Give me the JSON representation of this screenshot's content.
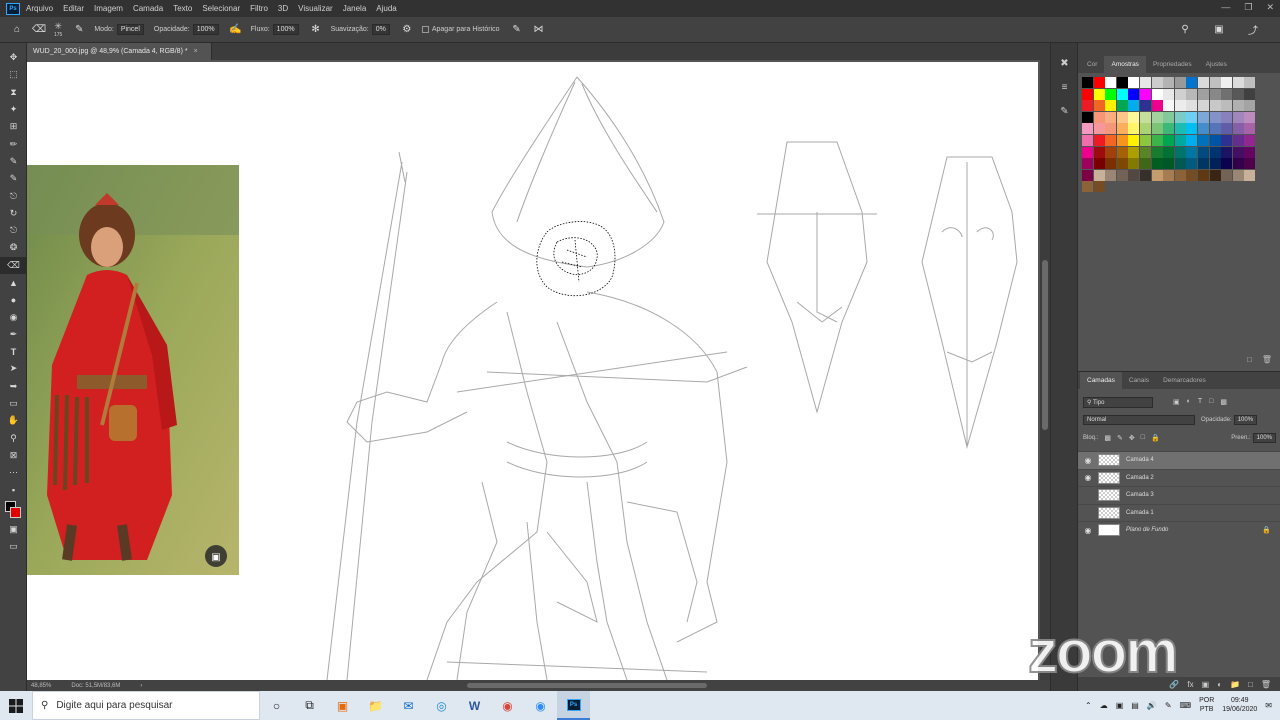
{
  "menubar": {
    "logo": "Ps",
    "items": [
      "Arquivo",
      "Editar",
      "Imagem",
      "Camada",
      "Texto",
      "Selecionar",
      "Filtro",
      "3D",
      "Visualizar",
      "Janela",
      "Ajuda"
    ]
  },
  "options": {
    "brush_size": "175",
    "mode_label": "Modo:",
    "mode_value": "Pincel",
    "opacity_label": "Opacidade:",
    "opacity_value": "100%",
    "flow_label": "Fluxo:",
    "flow_value": "100%",
    "smoothing_label": "Suavização:",
    "smoothing_value": "0%",
    "erase_history_label": "Apagar para Histórico"
  },
  "document": {
    "tab_title": "WUD_20_000.jpg @ 48,9% (Camada 4, RGB/8) *",
    "status_zoom": "48,85%",
    "status_doc": "Doc: 51,5M/83,6M"
  },
  "right_panel": {
    "top_tabs": [
      "Cor",
      "Amostras",
      "Propriedades",
      "Ajustes"
    ],
    "active_top_tab": "Amostras",
    "swatch_colors": [
      "#000000",
      "#ff0000",
      "#ffffff",
      "#000000",
      "#ffffff",
      "#e6e6e6",
      "#cccccc",
      "#b3b3b3",
      "#999999",
      "#0073cf",
      "#d9d9d9",
      "#c0c0c0",
      "#f0f0f0",
      "#dcdcdc",
      "#bfbfbf",
      "#ff0000",
      "#ffff00",
      "#00ff00",
      "#00ffff",
      "#0000ff",
      "#ff00ff",
      "#ffffff",
      "#e8e8e8",
      "#d0d0d0",
      "#b8b8b8",
      "#a0a0a0",
      "#888888",
      "#707070",
      "#585858",
      "#404040",
      "#ed1c24",
      "#f26522",
      "#fff200",
      "#00a651",
      "#00aeef",
      "#2e3192",
      "#ec008c",
      "#f7f7f7",
      "#ececec",
      "#e0e0e0",
      "#d4d4d4",
      "#c8c8c8",
      "#bcbcbc",
      "#b0b0b0",
      "#a4a4a4",
      "#000000",
      "#f69679",
      "#f9ad81",
      "#fdc689",
      "#fff799",
      "#c4df9b",
      "#a3d39c",
      "#82ca9c",
      "#7accc8",
      "#6dcff6",
      "#7da7d9",
      "#8393ca",
      "#8781bd",
      "#a186be",
      "#bd8cbf",
      "#f49ac1",
      "#f5989d",
      "#f7977a",
      "#fbaf5d",
      "#fff568",
      "#acd373",
      "#7cc576",
      "#3cb878",
      "#1cbbb4",
      "#00bff3",
      "#448ccb",
      "#5674b9",
      "#605ca8",
      "#855fa8",
      "#a763a8",
      "#f06eaa",
      "#ed1c24",
      "#f26522",
      "#f7941d",
      "#fff200",
      "#8dc63f",
      "#39b54a",
      "#00a651",
      "#00a99d",
      "#00aeef",
      "#0072bc",
      "#0054a6",
      "#2e3192",
      "#662d91",
      "#92278f",
      "#ec008c",
      "#9e0b0f",
      "#a0410d",
      "#a3620a",
      "#aba000",
      "#598527",
      "#197b30",
      "#007236",
      "#00746b",
      "#0076a3",
      "#004a80",
      "#003471",
      "#1b1464",
      "#440e62",
      "#630460",
      "#9e005d",
      "#790000",
      "#7b2e00",
      "#7d4900",
      "#827b00",
      "#406618",
      "#005e20",
      "#005826",
      "#005952",
      "#005b7f",
      "#003663",
      "#002157",
      "#0d004c",
      "#32004b",
      "#4b0049",
      "#7b0046",
      "#c7b299",
      "#998675",
      "#736357",
      "#534741",
      "#37302a",
      "#c69c6d",
      "#a67c52",
      "#8c6239",
      "#754c24",
      "#603913",
      "#3c2415",
      "#736357",
      "#998675",
      "#c7b299",
      "#8c6239",
      "#754c24"
    ],
    "layers": {
      "tabs": [
        "Camadas",
        "Canais",
        "Demarcadores"
      ],
      "active_tab": "Camadas",
      "filter_label": "Tipo",
      "blend_mode": "Normal",
      "opacity_label": "Opacidade:",
      "opacity_value": "100%",
      "lock_label": "Bloq.:",
      "fill_label": "Preen.:",
      "fill_value": "100%",
      "items": [
        {
          "name": "Camada 4",
          "visible": true,
          "selected": true
        },
        {
          "name": "Camada 2",
          "visible": true,
          "selected": false
        },
        {
          "name": "Camada 3",
          "visible": false,
          "selected": false
        },
        {
          "name": "Camada 1",
          "visible": false,
          "selected": false
        },
        {
          "name": "Plano de Fundo",
          "visible": true,
          "selected": false,
          "italic": true,
          "locked": true
        }
      ]
    }
  },
  "watermark": "zoom",
  "taskbar": {
    "search_placeholder": "Digite aqui para pesquisar",
    "lang_line1": "POR",
    "lang_line2": "PTB",
    "time": "09:49",
    "date": "19/06/2020"
  }
}
